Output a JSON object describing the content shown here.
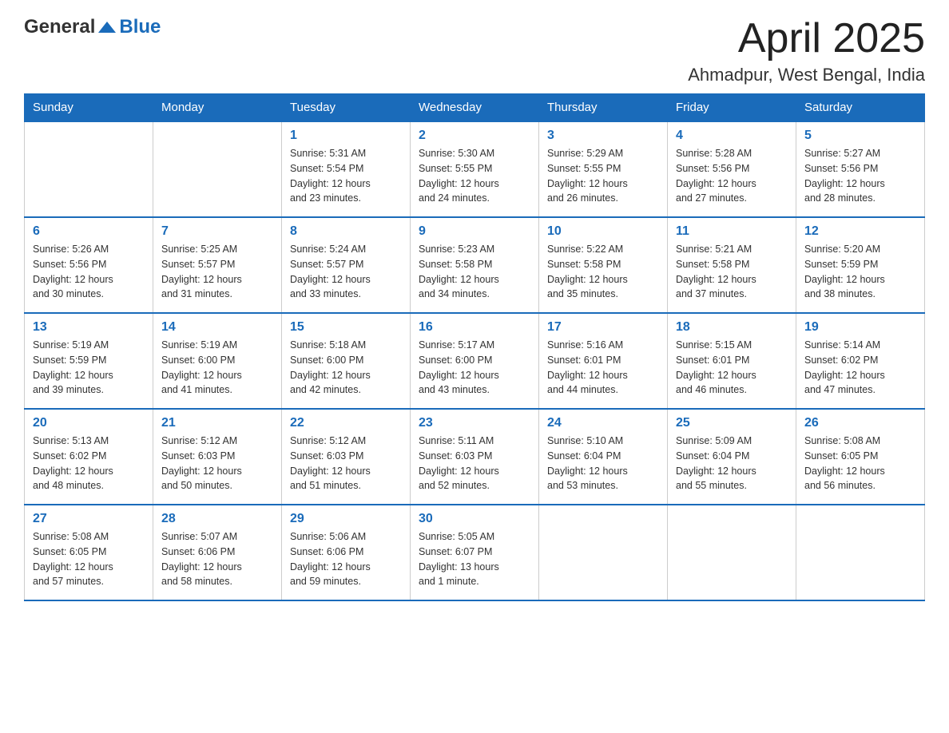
{
  "header": {
    "logo": {
      "general": "General",
      "blue": "Blue"
    },
    "title": "April 2025",
    "location": "Ahmadpur, West Bengal, India"
  },
  "weekdays": [
    "Sunday",
    "Monday",
    "Tuesday",
    "Wednesday",
    "Thursday",
    "Friday",
    "Saturday"
  ],
  "weeks": [
    [
      {
        "day": "",
        "info": ""
      },
      {
        "day": "",
        "info": ""
      },
      {
        "day": "1",
        "info": "Sunrise: 5:31 AM\nSunset: 5:54 PM\nDaylight: 12 hours\nand 23 minutes."
      },
      {
        "day": "2",
        "info": "Sunrise: 5:30 AM\nSunset: 5:55 PM\nDaylight: 12 hours\nand 24 minutes."
      },
      {
        "day": "3",
        "info": "Sunrise: 5:29 AM\nSunset: 5:55 PM\nDaylight: 12 hours\nand 26 minutes."
      },
      {
        "day": "4",
        "info": "Sunrise: 5:28 AM\nSunset: 5:56 PM\nDaylight: 12 hours\nand 27 minutes."
      },
      {
        "day": "5",
        "info": "Sunrise: 5:27 AM\nSunset: 5:56 PM\nDaylight: 12 hours\nand 28 minutes."
      }
    ],
    [
      {
        "day": "6",
        "info": "Sunrise: 5:26 AM\nSunset: 5:56 PM\nDaylight: 12 hours\nand 30 minutes."
      },
      {
        "day": "7",
        "info": "Sunrise: 5:25 AM\nSunset: 5:57 PM\nDaylight: 12 hours\nand 31 minutes."
      },
      {
        "day": "8",
        "info": "Sunrise: 5:24 AM\nSunset: 5:57 PM\nDaylight: 12 hours\nand 33 minutes."
      },
      {
        "day": "9",
        "info": "Sunrise: 5:23 AM\nSunset: 5:58 PM\nDaylight: 12 hours\nand 34 minutes."
      },
      {
        "day": "10",
        "info": "Sunrise: 5:22 AM\nSunset: 5:58 PM\nDaylight: 12 hours\nand 35 minutes."
      },
      {
        "day": "11",
        "info": "Sunrise: 5:21 AM\nSunset: 5:58 PM\nDaylight: 12 hours\nand 37 minutes."
      },
      {
        "day": "12",
        "info": "Sunrise: 5:20 AM\nSunset: 5:59 PM\nDaylight: 12 hours\nand 38 minutes."
      }
    ],
    [
      {
        "day": "13",
        "info": "Sunrise: 5:19 AM\nSunset: 5:59 PM\nDaylight: 12 hours\nand 39 minutes."
      },
      {
        "day": "14",
        "info": "Sunrise: 5:19 AM\nSunset: 6:00 PM\nDaylight: 12 hours\nand 41 minutes."
      },
      {
        "day": "15",
        "info": "Sunrise: 5:18 AM\nSunset: 6:00 PM\nDaylight: 12 hours\nand 42 minutes."
      },
      {
        "day": "16",
        "info": "Sunrise: 5:17 AM\nSunset: 6:00 PM\nDaylight: 12 hours\nand 43 minutes."
      },
      {
        "day": "17",
        "info": "Sunrise: 5:16 AM\nSunset: 6:01 PM\nDaylight: 12 hours\nand 44 minutes."
      },
      {
        "day": "18",
        "info": "Sunrise: 5:15 AM\nSunset: 6:01 PM\nDaylight: 12 hours\nand 46 minutes."
      },
      {
        "day": "19",
        "info": "Sunrise: 5:14 AM\nSunset: 6:02 PM\nDaylight: 12 hours\nand 47 minutes."
      }
    ],
    [
      {
        "day": "20",
        "info": "Sunrise: 5:13 AM\nSunset: 6:02 PM\nDaylight: 12 hours\nand 48 minutes."
      },
      {
        "day": "21",
        "info": "Sunrise: 5:12 AM\nSunset: 6:03 PM\nDaylight: 12 hours\nand 50 minutes."
      },
      {
        "day": "22",
        "info": "Sunrise: 5:12 AM\nSunset: 6:03 PM\nDaylight: 12 hours\nand 51 minutes."
      },
      {
        "day": "23",
        "info": "Sunrise: 5:11 AM\nSunset: 6:03 PM\nDaylight: 12 hours\nand 52 minutes."
      },
      {
        "day": "24",
        "info": "Sunrise: 5:10 AM\nSunset: 6:04 PM\nDaylight: 12 hours\nand 53 minutes."
      },
      {
        "day": "25",
        "info": "Sunrise: 5:09 AM\nSunset: 6:04 PM\nDaylight: 12 hours\nand 55 minutes."
      },
      {
        "day": "26",
        "info": "Sunrise: 5:08 AM\nSunset: 6:05 PM\nDaylight: 12 hours\nand 56 minutes."
      }
    ],
    [
      {
        "day": "27",
        "info": "Sunrise: 5:08 AM\nSunset: 6:05 PM\nDaylight: 12 hours\nand 57 minutes."
      },
      {
        "day": "28",
        "info": "Sunrise: 5:07 AM\nSunset: 6:06 PM\nDaylight: 12 hours\nand 58 minutes."
      },
      {
        "day": "29",
        "info": "Sunrise: 5:06 AM\nSunset: 6:06 PM\nDaylight: 12 hours\nand 59 minutes."
      },
      {
        "day": "30",
        "info": "Sunrise: 5:05 AM\nSunset: 6:07 PM\nDaylight: 13 hours\nand 1 minute."
      },
      {
        "day": "",
        "info": ""
      },
      {
        "day": "",
        "info": ""
      },
      {
        "day": "",
        "info": ""
      }
    ]
  ]
}
